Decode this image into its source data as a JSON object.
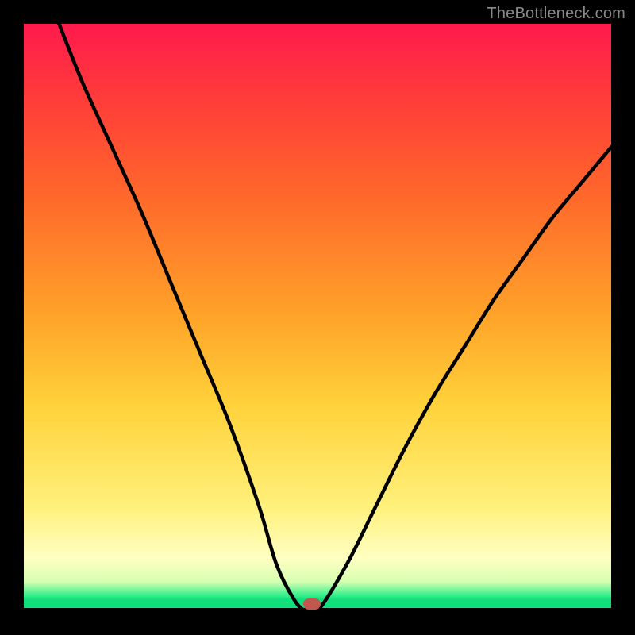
{
  "watermark": "TheBottleneck.com",
  "chart_data": {
    "type": "line",
    "title": "",
    "xlabel": "",
    "ylabel": "",
    "xlim": [
      0,
      100
    ],
    "ylim": [
      0,
      100
    ],
    "grid": false,
    "legend": false,
    "series": [
      {
        "name": "bottleneck-curve",
        "x": [
          6,
          10,
          15,
          20,
          25,
          30,
          35,
          40,
          43,
          46,
          48,
          50,
          55,
          60,
          65,
          70,
          75,
          80,
          85,
          90,
          95,
          100
        ],
        "y": [
          100,
          90,
          79,
          68,
          56,
          44,
          32,
          18,
          8,
          2,
          0,
          0,
          8,
          18,
          28,
          37,
          45,
          53,
          60,
          67,
          73,
          79
        ]
      }
    ],
    "marker": {
      "x": 49,
      "y": 1.2,
      "label": "optimal-point"
    },
    "background_gradient": {
      "stops": [
        {
          "pos": 0,
          "color": "#ff1a4d"
        },
        {
          "pos": 50,
          "color": "#ffa429"
        },
        {
          "pos": 82,
          "color": "#fff07a"
        },
        {
          "pos": 97,
          "color": "#3bf18e"
        },
        {
          "pos": 100,
          "color": "#12e07a"
        }
      ]
    }
  }
}
